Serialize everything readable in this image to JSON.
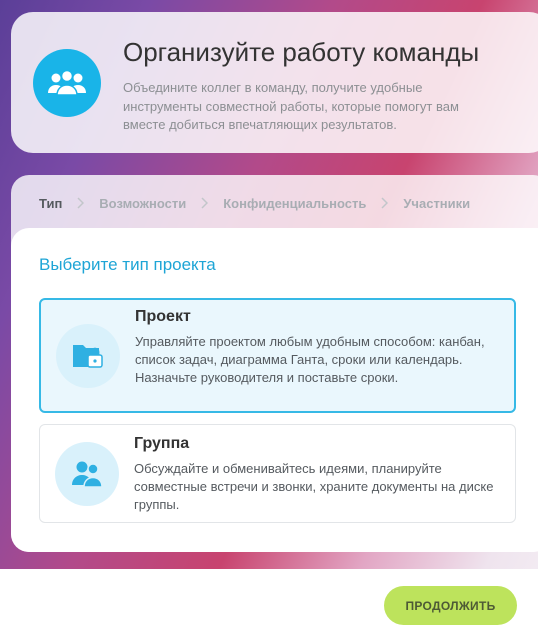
{
  "header": {
    "title": "Организуйте работу команды",
    "description": "Объедините коллег в команду, получите удобные инструменты совместной работы, которые помогут вам вместе добиться впечатляющих результатов.",
    "icon": "team-icon"
  },
  "steps": [
    {
      "label": "Тип",
      "active": true
    },
    {
      "label": "Возможности",
      "active": false
    },
    {
      "label": "Конфиденциальность",
      "active": false
    },
    {
      "label": "Участники",
      "active": false
    }
  ],
  "section_title": "Выберите тип проекта",
  "options": [
    {
      "title": "Проект",
      "description": "Управляйте проектом любым удобным способом: канбан, список задач, диаграмма Ганта, сроки или календарь. Назначьте руководителя и поставьте сроки.",
      "icon": "locked-folder-icon",
      "selected": true
    },
    {
      "title": "Группа",
      "description": "Обсуждайте и обменивайтесь идеями, планируйте совместные встречи и звонки, храните документы на диске группы.",
      "icon": "group-icon",
      "selected": false
    }
  ],
  "footer": {
    "continue_label": "ПРОДОЛЖИТЬ"
  },
  "colors": {
    "accent": "#19b4e8",
    "section_title": "#1ea5d6",
    "button": "#bde35c",
    "selected_border": "#36b9e6"
  }
}
